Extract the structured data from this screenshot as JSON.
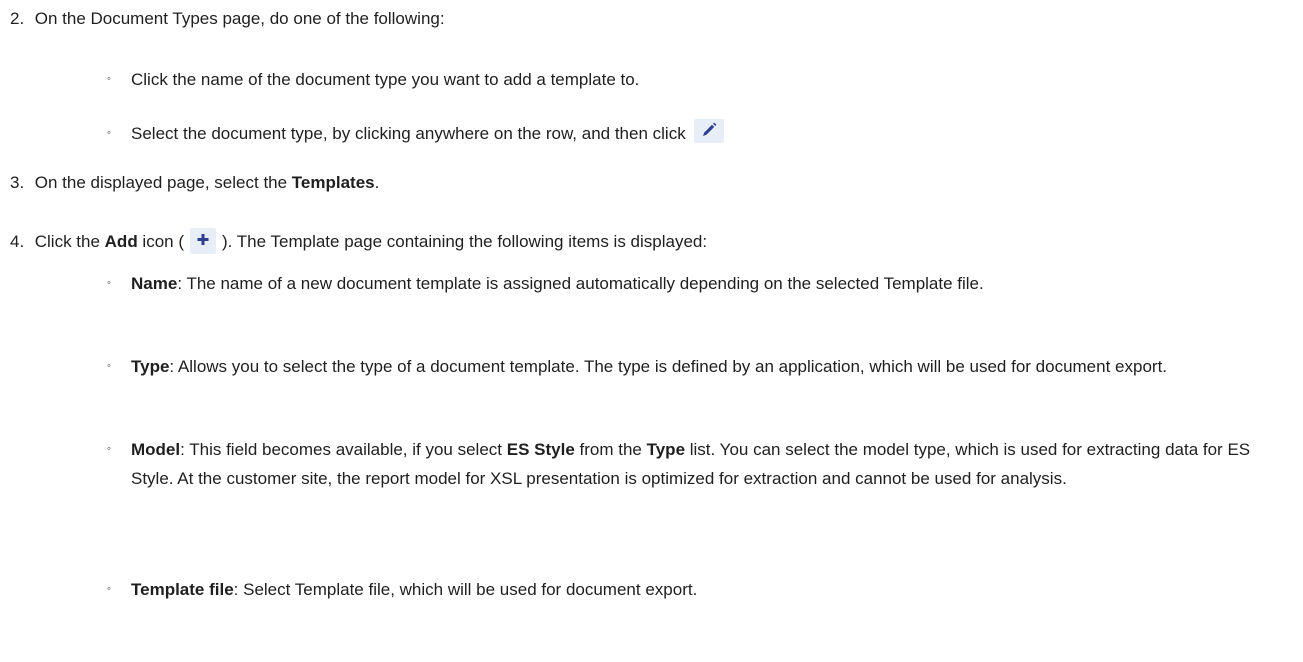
{
  "steps": [
    {
      "num": "2.",
      "text": "On the Document Types page, do one of the following:"
    },
    {
      "num": "3.",
      "pre": "On the displayed page, select the ",
      "bold": "Templates",
      "post": "."
    },
    {
      "num": "4.",
      "pre": "Click the ",
      "bold": "Add",
      "mid": " icon (",
      "post": "). The Template page containing the following items is displayed:"
    }
  ],
  "step2_items": [
    {
      "text": "Click the name of the document type you want to add a template to."
    },
    {
      "text": "Select the document type, by clicking anywhere on the row, and then click"
    }
  ],
  "step4_items": [
    {
      "term": "Name",
      "text": ": The name of a new document template is assigned automatically depending on the selected Template file."
    },
    {
      "term": "Type",
      "text": ": Allows you to select the type of a document template. The type is defined by an application, which will be used for document export."
    },
    {
      "term": "Model",
      "part1": ": This field becomes available, if you select ",
      "bold1": "ES Style",
      "part2": " from the ",
      "bold2": "Type",
      "part3": " list. You can select the model type, which is used for extracting data for ES Style. At the customer site, the report model for XSL presentation is optimized for extraction and cannot be used for analysis."
    },
    {
      "term": "Template file",
      "text": ": Select Template file, which will be used for document export."
    }
  ],
  "icons": {
    "edit": "pencil-icon",
    "add": "plus-icon"
  },
  "colors": {
    "icon_bg": "#e8eef8",
    "icon_fg": "#2e3f8f",
    "text": "#1f1f1f"
  }
}
